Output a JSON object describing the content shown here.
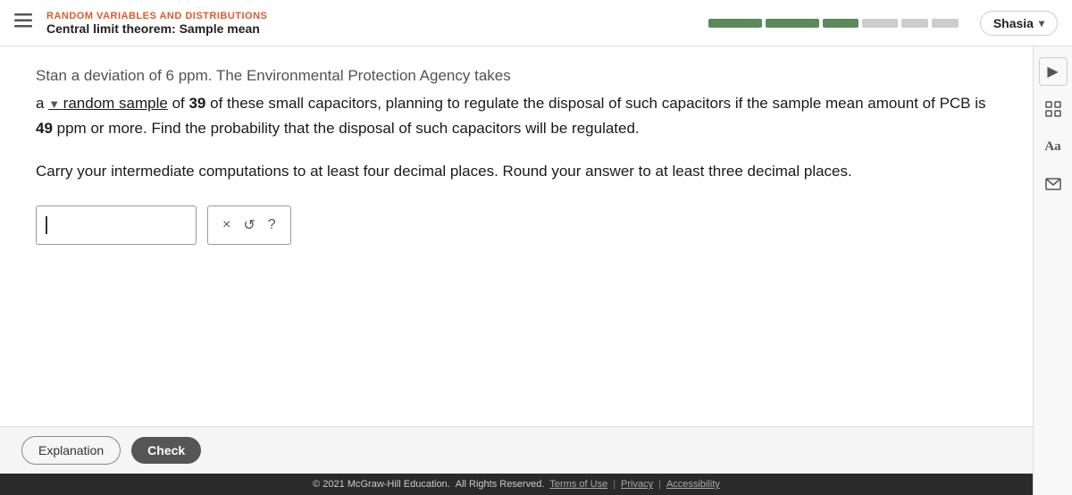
{
  "navbar": {
    "hamburger_label": "☰",
    "subtitle": "RANDOM VARIABLES AND DISTRIBUTIONS",
    "title": "Central limit theorem: Sample mean",
    "user_name": "Shasia",
    "chevron": "▾"
  },
  "progress": {
    "segments": [
      {
        "type": "wide",
        "filled": true
      },
      {
        "type": "wide",
        "filled": true
      },
      {
        "type": "medium",
        "filled": true
      },
      {
        "type": "medium",
        "filled": false
      },
      {
        "type": "narrow",
        "filled": false
      },
      {
        "type": "narrow",
        "filled": false
      }
    ]
  },
  "problem": {
    "cutoff_text": "Stan      a deviation of 6 ppm. The Environmental Protection Agency takes",
    "main_text_1": "a random sample",
    "main_text_2": " of ",
    "main_text_39": "39",
    "main_text_3": " of these small capacitors, planning to regulate the disposal of such capacitors if the sample mean amount of PCB is ",
    "main_text_49": "49",
    "main_text_4": " ppm or more. Find the probability that the disposal of such capacitors will be regulated.",
    "instruction": "Carry your intermediate computations to at least four decimal places. Round your answer to at least three decimal places."
  },
  "answer_area": {
    "placeholder": "",
    "cursor_char": "|"
  },
  "action_buttons": {
    "clear_label": "×",
    "reset_label": "↺",
    "help_label": "?"
  },
  "bottom_bar": {
    "explanation_label": "Explanation",
    "check_label": "Check"
  },
  "footer": {
    "copyright": "© 2021 McGraw-Hill Education.",
    "rights": "All Rights Reserved.",
    "terms": "Terms of Use",
    "privacy": "Privacy",
    "accessibility": "Accessibility"
  },
  "sidebar_icons": {
    "play": "▶",
    "grid": "⊞",
    "text": "Aa",
    "envelope": "✉"
  }
}
